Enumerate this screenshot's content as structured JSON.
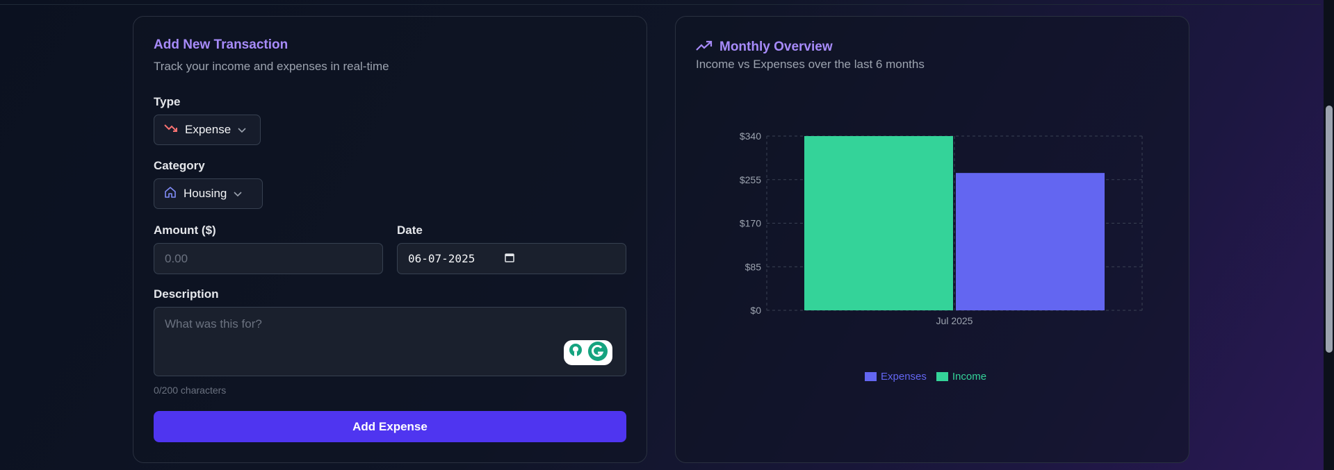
{
  "form": {
    "title": "Add New Transaction",
    "subtitle": "Track your income and expenses in real-time",
    "type_label": "Type",
    "type_value": "Expense",
    "category_label": "Category",
    "category_value": "Housing",
    "amount_label": "Amount ($)",
    "amount_placeholder": "0.00",
    "date_label": "Date",
    "date_value": "06-07-2025",
    "description_label": "Description",
    "description_placeholder": "What was this for?",
    "char_count": "0/200 characters",
    "submit_label": "Add Expense",
    "icons": {
      "type": "trending-down-icon",
      "category": "home-icon",
      "chevron": "chevron-down-icon",
      "calendar": "calendar-icon"
    }
  },
  "overview": {
    "title": "Monthly Overview",
    "subtitle": "Income vs Expenses over the last 6 months",
    "icon": "trending-up-icon"
  },
  "chart_data": {
    "type": "bar",
    "categories": [
      "Jul 2025"
    ],
    "series": [
      {
        "name": "Income",
        "values": [
          340
        ],
        "color": "#34d399"
      },
      {
        "name": "Expenses",
        "values": [
          268
        ],
        "color": "#6366f1"
      }
    ],
    "yticks": [
      "$0",
      "$85",
      "$170",
      "$255",
      "$340"
    ],
    "ytick_values": [
      0,
      85,
      170,
      255,
      340
    ],
    "ylim": [
      0,
      340
    ],
    "grid": true,
    "legend_position": "bottom",
    "legend": [
      {
        "label": "Expenses",
        "color": "#6366f1"
      },
      {
        "label": "Income",
        "color": "#34d399"
      }
    ]
  },
  "colors": {
    "accent": "#a78bfa",
    "button": "#4f35f0",
    "expense_icon": "#f87171"
  }
}
